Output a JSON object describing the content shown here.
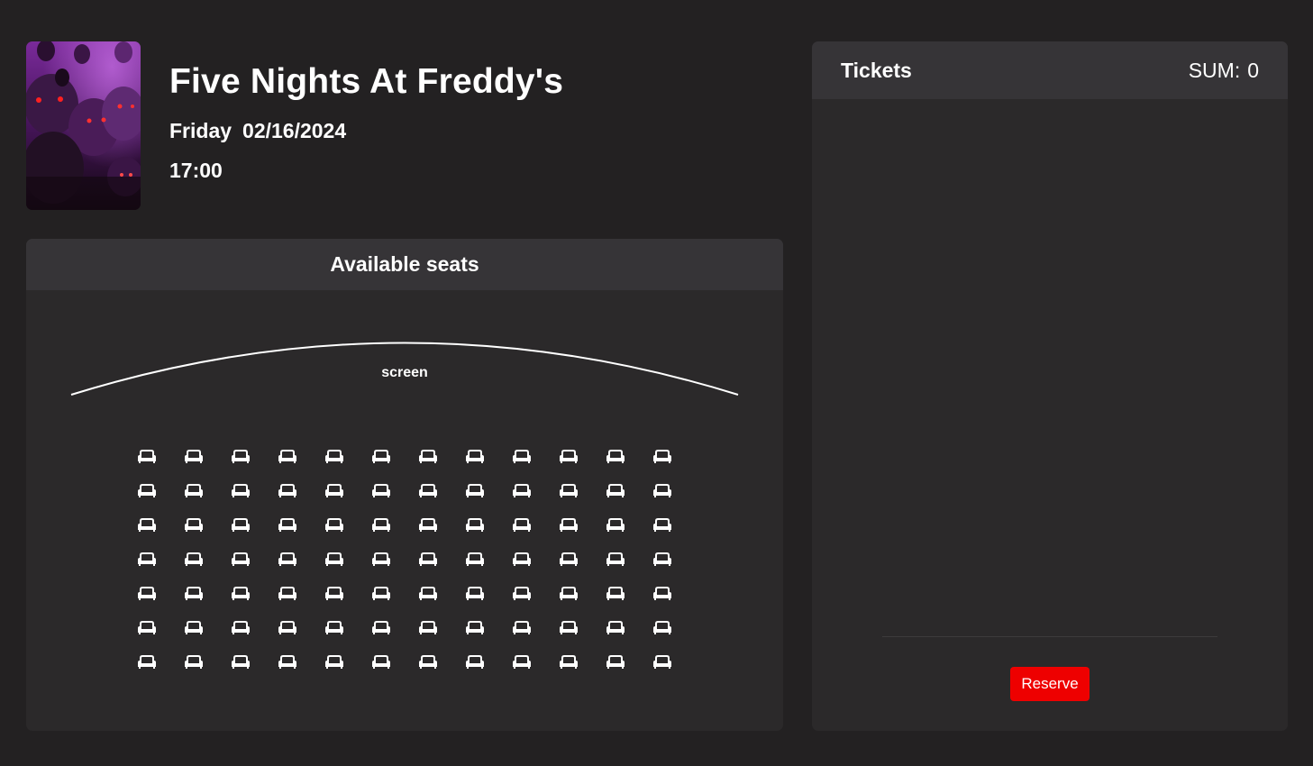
{
  "movie": {
    "title": "Five Nights At Freddy's",
    "day": "Friday",
    "date": "02/16/2024",
    "time": "17:00",
    "poster_icon": "movie-poster"
  },
  "seating": {
    "header": "Available seats",
    "screen_label": "screen",
    "rows": 7,
    "seats_per_row": 12,
    "seat_icon": "sofa-icon",
    "seat_color": "#ffffff"
  },
  "tickets": {
    "title": "Tickets",
    "sum_label": "SUM:",
    "sum_value": "0",
    "items": [],
    "reserve_label": "Reserve"
  },
  "colors": {
    "background": "#232122",
    "panel": "#2b292a",
    "panel_header": "#363437",
    "accent": "#ee0000"
  }
}
